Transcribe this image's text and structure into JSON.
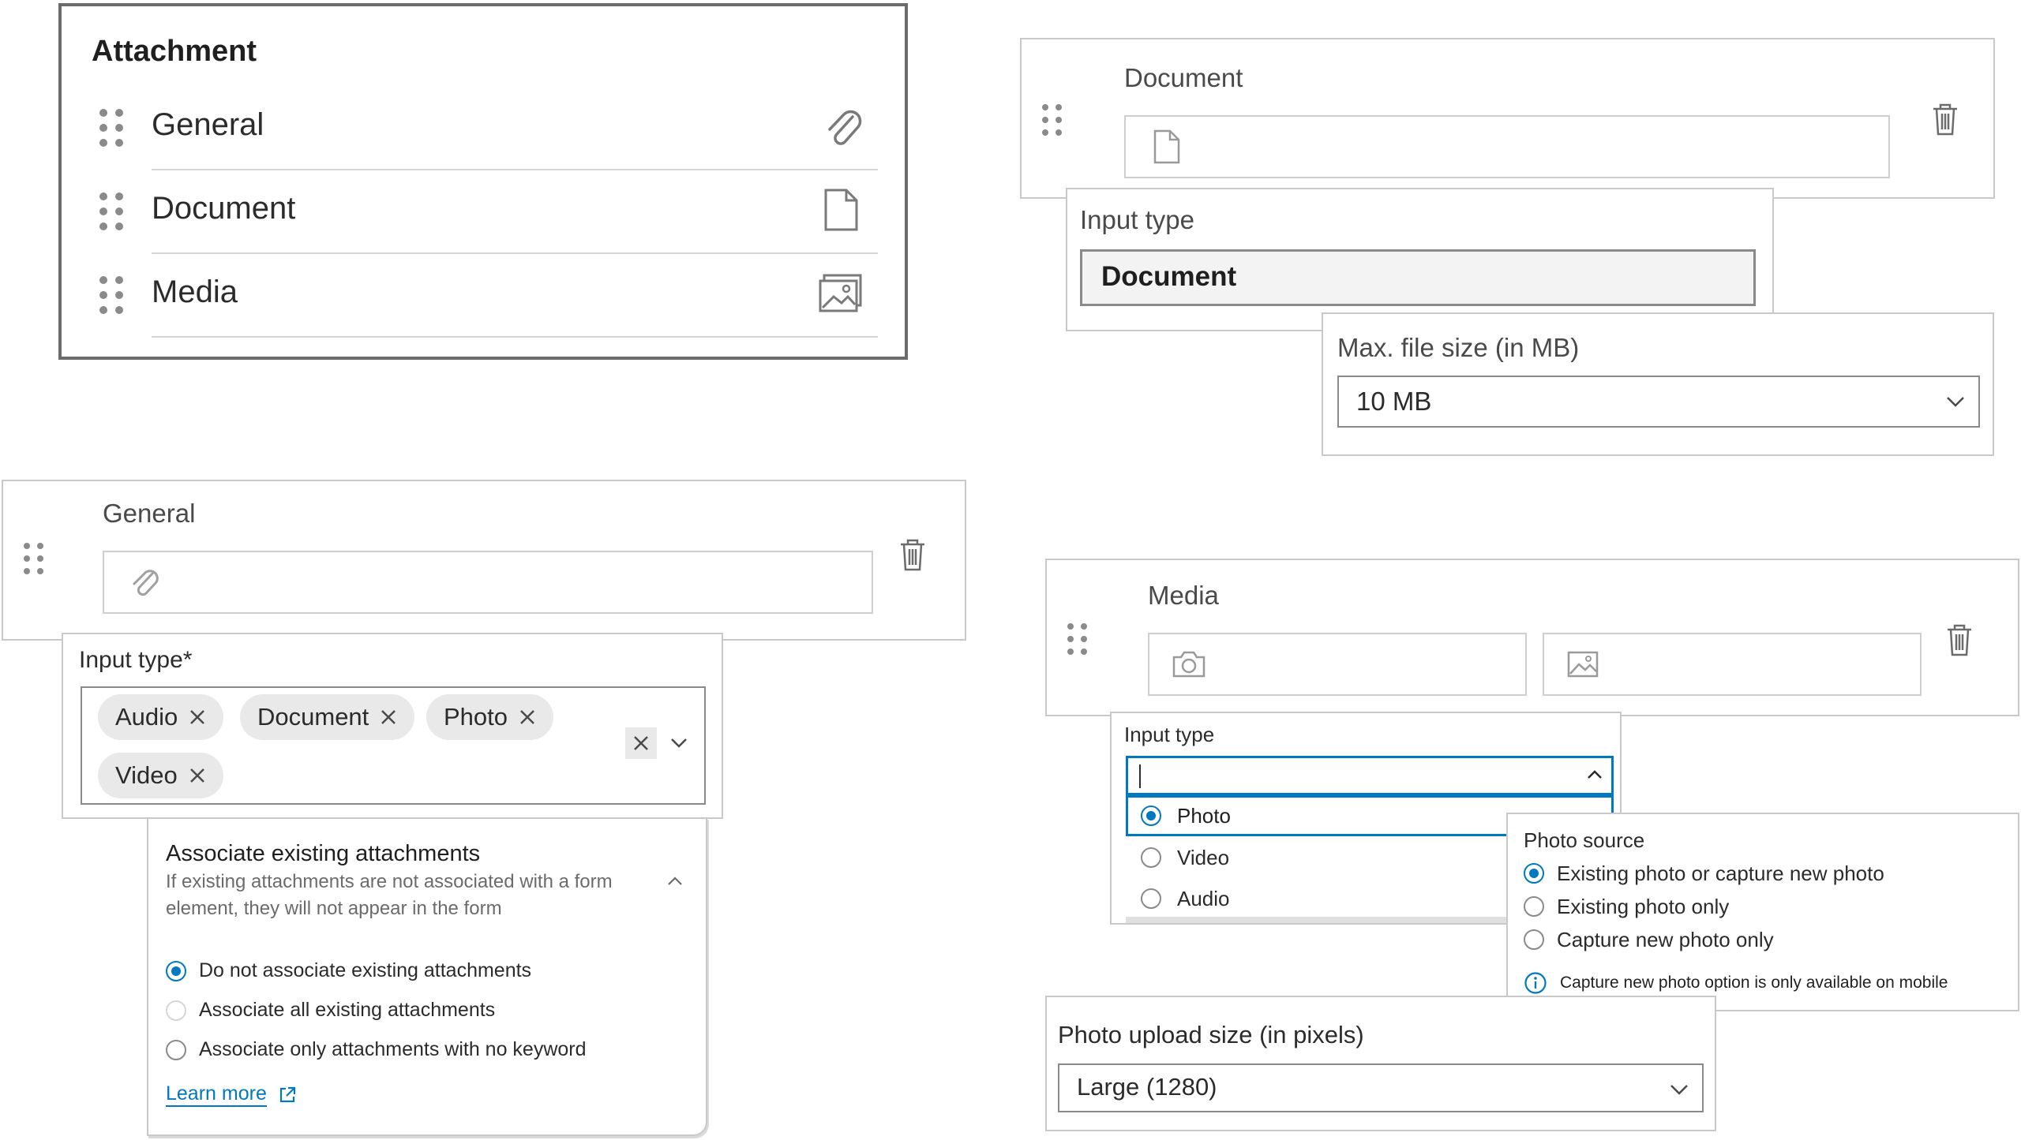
{
  "attachment_list": {
    "title": "Attachment",
    "items": [
      {
        "label": "General",
        "icon": "paperclip-icon"
      },
      {
        "label": "Document",
        "icon": "document-icon"
      },
      {
        "label": "Media",
        "icon": "image-icon"
      }
    ]
  },
  "document_element": {
    "label": "Document",
    "input_type_label": "Input type",
    "input_type_value": "Document",
    "max_size_label": "Max. file size (in MB)",
    "max_size_value": "10 MB"
  },
  "general_element": {
    "label": "General",
    "input_type_label": "Input type*",
    "chips": [
      "Audio",
      "Document",
      "Photo",
      "Video"
    ],
    "associate_title": "Associate existing attachments",
    "associate_desc_line1": "If existing attachments are not associated with a form",
    "associate_desc_line2": "element, they will not appear in the form",
    "options": [
      "Do not associate existing attachments",
      "Associate all existing attachments",
      "Associate only attachments with no keyword"
    ],
    "selected_option": "Do not associate existing attachments",
    "learn_more": "Learn more"
  },
  "media_element": {
    "label": "Media",
    "input_type_label": "Input type",
    "input_type_options": [
      "Photo",
      "Video",
      "Audio"
    ],
    "input_type_selected": "Photo",
    "photo_source_label": "Photo source",
    "photo_source_options": [
      "Existing photo or capture new photo",
      "Existing photo only",
      "Capture new photo only"
    ],
    "photo_source_selected": "Existing photo or capture new photo",
    "info_note": "Capture new photo option is only available on mobile",
    "upload_size_label": "Photo upload size (in pixels)",
    "upload_size_value": "Large (1280)"
  },
  "colors": {
    "accent": "#0079c1",
    "border": "#c9c9c9",
    "chip": "#e9e9e9"
  }
}
